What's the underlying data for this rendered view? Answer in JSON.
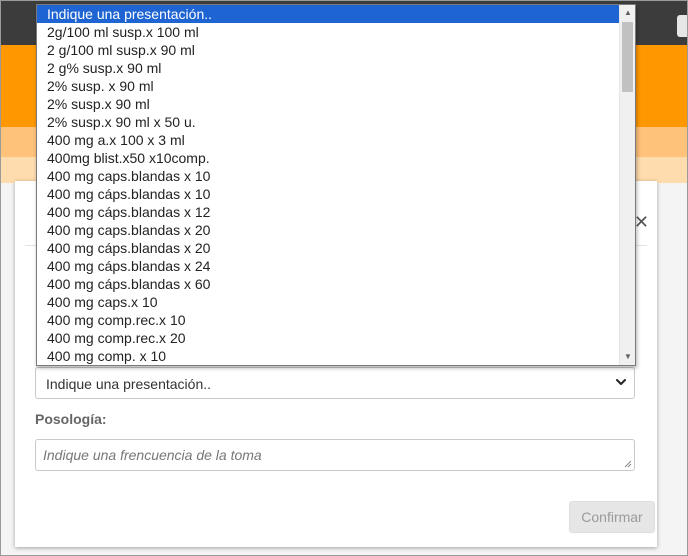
{
  "modal": {
    "close_symbol": "✕",
    "select": {
      "value": "Indique una presentación.."
    },
    "posologia": {
      "label": "Posología:",
      "placeholder": "Indique una frencuencia de la toma"
    },
    "confirm_label": "Confirmar"
  },
  "dropdown": {
    "options": [
      {
        "label": "Indique una presentación..",
        "selected": true
      },
      {
        "label": "2g/100 ml susp.x 100 ml",
        "selected": false
      },
      {
        "label": "2 g/100 ml susp.x 90 ml",
        "selected": false
      },
      {
        "label": "2 g% susp.x 90 ml",
        "selected": false
      },
      {
        "label": "2% susp. x 90 ml",
        "selected": false
      },
      {
        "label": "2% susp.x 90 ml",
        "selected": false
      },
      {
        "label": "2% susp.x 90 ml x 50 u.",
        "selected": false
      },
      {
        "label": "400 mg a.x 100 x 3 ml",
        "selected": false
      },
      {
        "label": "400mg blist.x50 x10comp.",
        "selected": false
      },
      {
        "label": "400 mg caps.blandas x 10",
        "selected": false
      },
      {
        "label": "400 mg cáps.blandas x 10",
        "selected": false
      },
      {
        "label": "400 mg cáps.blandas x 12",
        "selected": false
      },
      {
        "label": "400 mg caps.blandas x 20",
        "selected": false
      },
      {
        "label": "400 mg cáps.blandas x 20",
        "selected": false
      },
      {
        "label": "400 mg cáps.blandas x 24",
        "selected": false
      },
      {
        "label": "400 mg cáps.blandas x 60",
        "selected": false
      },
      {
        "label": "400 mg caps.x 10",
        "selected": false
      },
      {
        "label": "400 mg comp.rec.x 10",
        "selected": false
      },
      {
        "label": "400 mg comp.rec.x 20",
        "selected": false
      },
      {
        "label": "400 mg comp. x 10",
        "selected": false
      }
    ],
    "scroll": {
      "thumb_position_fraction": 0.0
    }
  },
  "colors": {
    "topbar": "#3c3c3c",
    "accent_orange": "#ff9800",
    "selected_option": "#1e64d2"
  }
}
